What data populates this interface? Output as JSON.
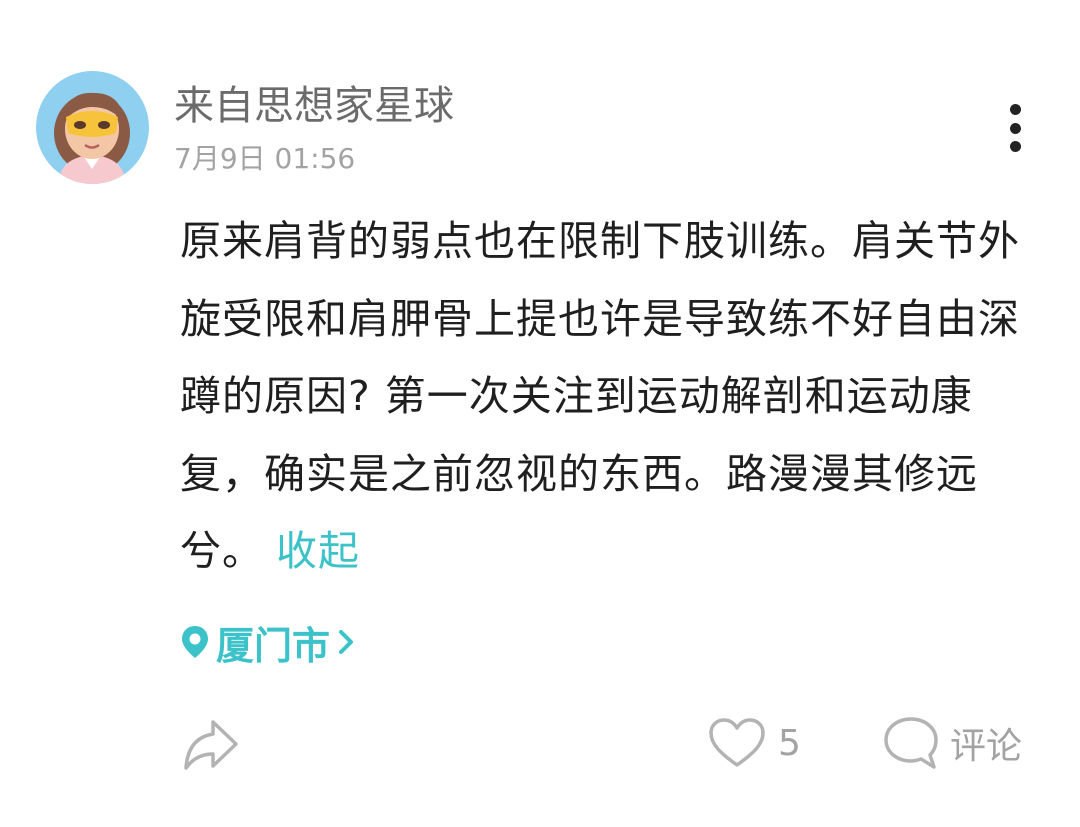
{
  "post": {
    "author_name": "来自思想家星球",
    "timestamp": "7月9日 01:56",
    "content": "原来肩背的弱点也在限制下肢训练。肩关节外旋受限和肩胛骨上提也许是导致练不好自由深蹲的原因? 第一次关注到运动解剖和运动康复，确实是之前忽视的东西。路漫漫其修远兮。",
    "collapse_label": "收起",
    "location": "厦门市"
  },
  "actions": {
    "like_count": "5",
    "comment_label": "评论"
  },
  "icons": {
    "avatar": "avatar-illustration",
    "more": "more-vertical-icon",
    "location": "location-pin-icon",
    "chevron": "chevron-right-icon",
    "share": "share-icon",
    "like": "heart-icon",
    "comment": "comment-bubble-icon"
  },
  "colors": {
    "accent": "#3cc2c9",
    "text_primary": "#1f1f1f",
    "text_secondary": "#a3a3a3",
    "avatar_background": "#8fd0f0"
  }
}
